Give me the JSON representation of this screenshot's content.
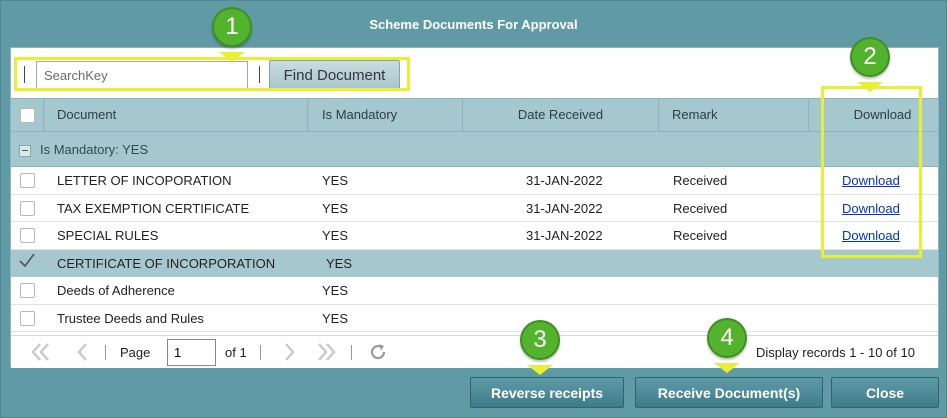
{
  "dialog": {
    "title": "Scheme Documents For Approval"
  },
  "search": {
    "placeholder": "SearchKey",
    "button_label": "Find Document"
  },
  "table": {
    "columns": {
      "document": "Document",
      "mandatory": "Is Mandatory",
      "date": "Date Received",
      "remark": "Remark",
      "download": "Download"
    },
    "group_label": "Is Mandatory: YES",
    "rows": [
      {
        "document": "LETTER OF INCOPORATION",
        "mandatory": "YES",
        "date": "31-JAN-2022",
        "remark": "Received",
        "download": "Download",
        "checked": false
      },
      {
        "document": "TAX EXEMPTION CERTIFICATE",
        "mandatory": "YES",
        "date": "31-JAN-2022",
        "remark": "Received",
        "download": "Download",
        "checked": false
      },
      {
        "document": "SPECIAL RULES",
        "mandatory": "YES",
        "date": "31-JAN-2022",
        "remark": "Received",
        "download": "Download",
        "checked": false
      },
      {
        "document": "CERTIFICATE OF INCORPORATION",
        "mandatory": "YES",
        "date": "",
        "remark": "",
        "download": "",
        "checked": true
      },
      {
        "document": "Deeds of Adherence",
        "mandatory": "YES",
        "date": "",
        "remark": "",
        "download": "",
        "checked": false
      },
      {
        "document": "Trustee Deeds and Rules",
        "mandatory": "YES",
        "date": "",
        "remark": "",
        "download": "",
        "checked": false
      }
    ]
  },
  "pager": {
    "page_label": "Page",
    "page_value": "1",
    "of_label": "of 1",
    "records_text": "Display records 1 - 10 of 10"
  },
  "footer": {
    "reverse_label": "Reverse receipts",
    "receive_label": "Receive Document(s)",
    "close_label": "Close"
  },
  "annotations": {
    "one": "1",
    "two": "2",
    "three": "3",
    "four": "4"
  },
  "colors": {
    "header_teal": "#5f9aa5",
    "grid_header": "#a4c8ce",
    "highlight_yellow": "#e9ef32",
    "badge_green": "#53b32d",
    "link_blue": "#0033cc"
  },
  "icons": [
    "first-page-icon",
    "prev-page-icon",
    "next-page-icon",
    "last-page-icon",
    "refresh-icon",
    "checkmark-icon",
    "collapse-icon"
  ]
}
